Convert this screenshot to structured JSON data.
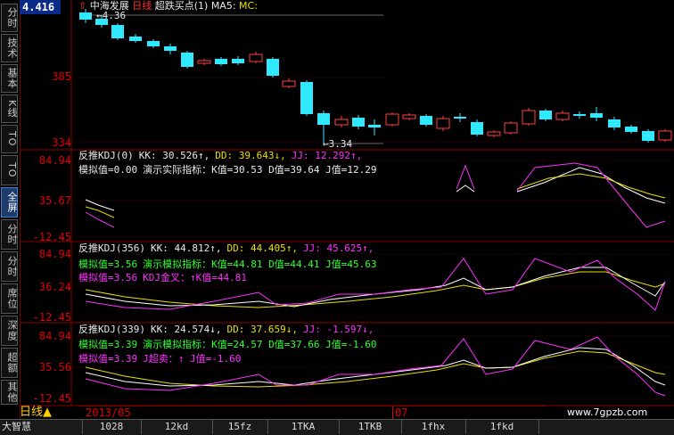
{
  "app": {
    "current_price": "4.416",
    "stock_name": "中海发展",
    "period": "日线",
    "indicator_title": "超跌买点(1)",
    "ma_label": "MA5:",
    "mc_label": "MC:",
    "high_label": "4.36",
    "low_label": "3.34",
    "arrow_glyph": "⇧"
  },
  "left_tabs": [
    {
      "label": "分时"
    },
    {
      "label": "技术"
    },
    {
      "label": "基本"
    },
    {
      "label": "K线"
    },
    {
      "label": "TO"
    },
    {
      "label": "TO"
    },
    {
      "label": "全屏"
    },
    {
      "label": "分时"
    },
    {
      "label": "分时"
    },
    {
      "label": "席位"
    },
    {
      "label": "深度"
    },
    {
      "label": "超额"
    },
    {
      "label": "其他"
    }
  ],
  "price_axis": {
    "labels": [
      "385",
      "334"
    ]
  },
  "panels": [
    {
      "axis": [
        "84.94",
        "35.67",
        "-12.45"
      ],
      "line1": {
        "name": "反推KDJ(0)",
        "kk": "KK: 30.526↑,",
        "dd": "DD: 39.643↓,",
        "jj": "JJ: 12.292↑,"
      },
      "line2": {
        "a": "模拟值=0.00",
        "b": "演示实际指标：K值=30.53 D值=39.64 J值=12.29"
      },
      "line3": {
        "a": "",
        "b": ""
      }
    },
    {
      "axis": [
        "84.94",
        "36.24",
        "-12.45"
      ],
      "line1": {
        "name": "反推KDJ(356)",
        "kk": "KK: 44.812↑,",
        "dd": "DD: 44.405↑,",
        "jj": "JJ: 45.625↑,"
      },
      "line2": {
        "a": "模拟值=3.56",
        "b": "演示模拟指标：K值=44.81 D值=44.41 J值=45.63"
      },
      "line3": {
        "a": "模拟值=3.56",
        "b": "KDJ金叉：↑K值=44.81"
      }
    },
    {
      "axis": [
        "84.94",
        "35.56",
        "-12.45"
      ],
      "line1": {
        "name": "反推KDJ(339)",
        "kk": "KK: 24.574↓,",
        "dd": "DD: 37.659↓,",
        "jj": "JJ: -1.597↓,"
      },
      "line2": {
        "a": "模拟值=3.39",
        "b": "演示模拟指标：K值=24.57 D值=37.66 J值=-1.60"
      },
      "line3": {
        "a": "模拟值=3.39",
        "b": "J超卖：↑     J值=-1.60"
      }
    }
  ],
  "date_axis": {
    "labels": [
      "2013/05",
      "07"
    ]
  },
  "day_line_label": "日线",
  "bottom_tabs": [
    {
      "label": "大智慧"
    },
    {
      "label": "1028"
    },
    {
      "label": "12kd"
    },
    {
      "label": "15fz"
    },
    {
      "label": "1TKA"
    },
    {
      "label": "1TKB"
    },
    {
      "label": "1fhx"
    },
    {
      "label": "1fkd"
    }
  ],
  "watermark": "www.7gpzb.com",
  "colors": {
    "up": "#ff4040",
    "down": "#30e8ff",
    "white_line": "#ffffff",
    "yellow_line": "#e8e000",
    "magenta_line": "#ff30ff",
    "grid_red": "#8a0000"
  }
}
